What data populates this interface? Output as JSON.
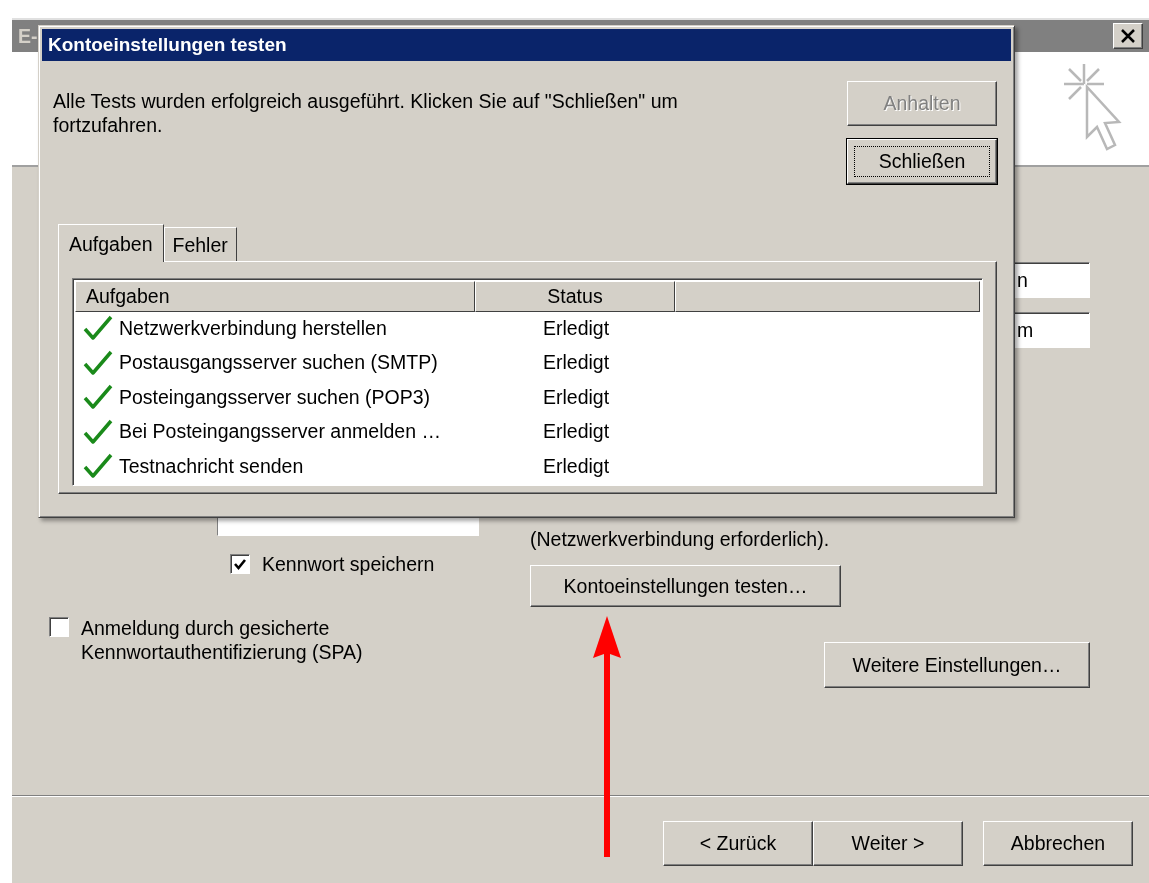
{
  "background_window": {
    "title": "E-",
    "fields": [
      {
        "value": "n"
      },
      {
        "value": "m"
      }
    ],
    "note": "(Netzwerkverbindung erforderlich).",
    "test_button": "Kontoeinstellungen testen…",
    "save_password": {
      "label": "Kennwort speichern",
      "checked": true
    },
    "spa": {
      "label": "Anmeldung durch gesicherte Kennwortauthentifizierung (SPA)",
      "checked": false
    },
    "more_settings_button": "Weitere Einstellungen…",
    "nav_buttons": [
      "< Zurück",
      "Weiter >",
      "Abbrechen"
    ]
  },
  "dialog": {
    "title": "Kontoeinstellungen testen",
    "message": "Alle Tests wurden erfolgreich ausgeführt. Klicken Sie auf \"Schließen\" um fortzufahren.",
    "buttons": [
      {
        "label": "Anhalten",
        "disabled": true,
        "focused": false
      },
      {
        "label": "Schließen",
        "disabled": false,
        "focused": true
      }
    ],
    "tabs": [
      {
        "label": "Aufgaben",
        "selected": true
      },
      {
        "label": "Fehler",
        "selected": false
      }
    ],
    "table": {
      "columns": [
        "Aufgaben",
        "Status"
      ],
      "rows": [
        {
          "task": "Netzwerkverbindung herstellen",
          "status": "Erledigt",
          "done": true
        },
        {
          "task": "Postausgangsserver suchen (SMTP)",
          "status": "Erledigt",
          "done": true
        },
        {
          "task": "Posteingangsserver suchen (POP3)",
          "status": "Erledigt",
          "done": true
        },
        {
          "task": "Bei Posteingangsserver anmelden …",
          "status": "Erledigt",
          "done": true
        },
        {
          "task": "Testnachricht senden",
          "status": "Erledigt",
          "done": true
        }
      ]
    }
  }
}
